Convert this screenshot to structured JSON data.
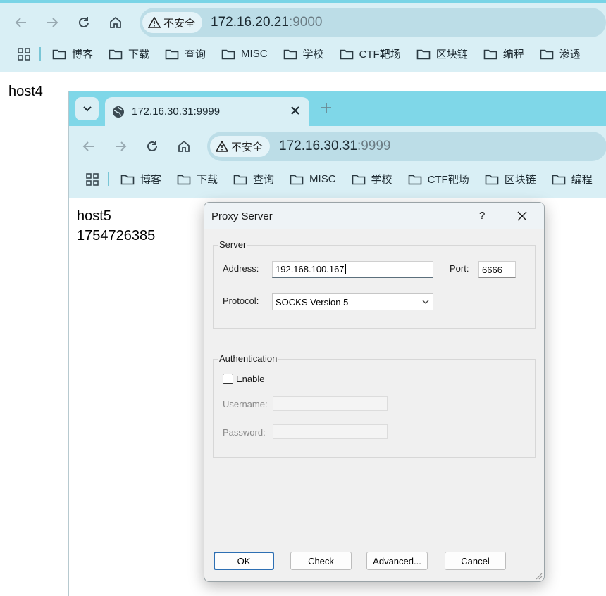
{
  "outer_browser": {
    "url_host": "172.16.20.21",
    "url_port": ":9000",
    "security_label": "不安全",
    "page_text": "host4",
    "bookmarks": [
      "博客",
      "下载",
      "查询",
      "MISC",
      "学校",
      "CTF靶场",
      "区块链",
      "编程",
      "渗透"
    ]
  },
  "inner_browser": {
    "tab_title": "172.16.30.31:9999",
    "url_host": "172.16.30.31",
    "url_port": ":9999",
    "security_label": "不安全",
    "page_lines": [
      "host5",
      "1754726385"
    ],
    "bookmarks": [
      "博客",
      "下载",
      "查询",
      "MISC",
      "学校",
      "CTF靶场",
      "区块链",
      "编程"
    ]
  },
  "dialog": {
    "title": "Proxy Server",
    "help_label": "?",
    "server_group": "Server",
    "address_label": "Address:",
    "address_value": "192.168.100.167",
    "port_label": "Port:",
    "port_value": "6666",
    "protocol_label": "Protocol:",
    "protocol_value": "SOCKS Version 5",
    "auth_group": "Authentication",
    "enable_label": "Enable",
    "enable_checked": false,
    "username_label": "Username:",
    "password_label": "Password:",
    "buttons": {
      "ok": "OK",
      "check": "Check",
      "advanced": "Advanced...",
      "cancel": "Cancel"
    }
  },
  "colors": {
    "tabstrip": "#7fd7e8",
    "toolbar": "#d9eff5",
    "omnibox": "#bcdde7",
    "dialog_bg": "#f0f0f0",
    "default_button_border": "#2d6fb3"
  }
}
